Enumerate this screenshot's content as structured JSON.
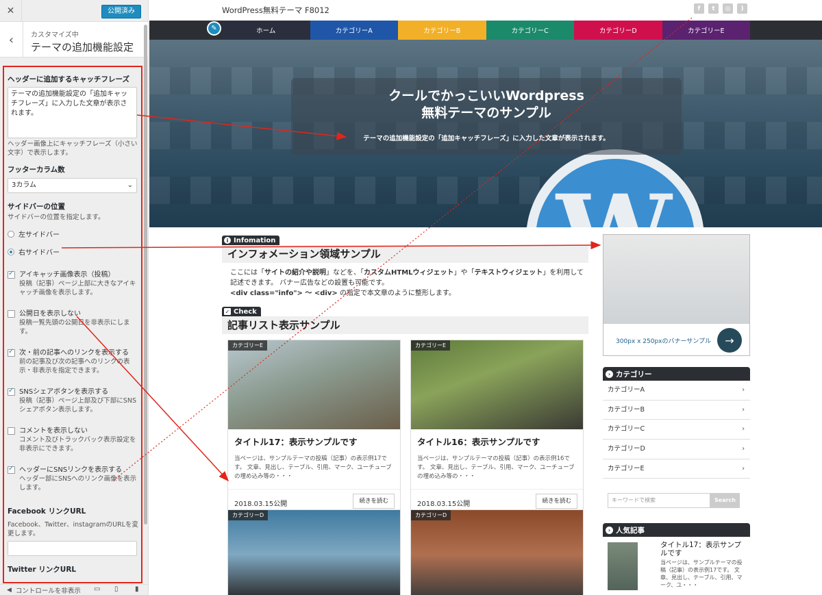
{
  "customizer": {
    "publish_label": "公開済み",
    "section_subtitle": "カスタマイズ中",
    "section_title": "テーマの追加機能設定",
    "catchphrase_label": "ヘッダーに追加するキャッチフレーズ",
    "catchphrase_value": "テーマの追加機能設定の「追加キャッチフレーズ」に入力した文章が表示されます。",
    "catchphrase_desc": "ヘッダー画像上にキャッチフレーズ（小さい文字）で表示します。",
    "footer_cols_label": "フッターカラム数",
    "footer_cols_value": "3カラム",
    "sidebar_pos_label": "サイドバーの位置",
    "sidebar_pos_desc": "サイドバーの位置を指定します。",
    "radio_left": "左サイドバー",
    "radio_right": "右サイドバー",
    "checks": [
      {
        "title": "アイキャッチ画像表示（投稿）",
        "desc": "投稿（記事）ページ上部に大きなアイキャッチ画像を表示します。",
        "checked": true
      },
      {
        "title": "公開日を表示しない",
        "desc": "投稿一覧先頭の公開日を非表示にします。",
        "checked": false
      },
      {
        "title": "次・前の記事へのリンクを表示する",
        "desc": "前の記事及び次の記事へのリンクの表示・非表示を指定できます。",
        "checked": true
      },
      {
        "title": "SNSシェアボタンを表示する",
        "desc": "投稿（記事）ページ上部及び下部にSNSシェアボタン表示します。",
        "checked": true
      },
      {
        "title": "コメントを表示しない",
        "desc": "コメント及びトラックバック表示設定を非表示にできます。",
        "checked": false
      },
      {
        "title": "ヘッダーにSNSリンクを表示する",
        "desc": "ヘッダー部にSNSへのリンク画像を表示します。",
        "checked": true
      }
    ],
    "facebook_label": "Facebook リンクURL",
    "facebook_desc": "Facebook、Twitter、instagramのURLを変更します。",
    "twitter_label": "Twitter リンクURL",
    "hide_controls": "コントロールを非表示"
  },
  "site": {
    "title": "WordPress無料テーマ F8012",
    "nav": [
      {
        "label": "ホーム",
        "color": "#2b2f3d"
      },
      {
        "label": "カテゴリーA",
        "color": "#1f56a8"
      },
      {
        "label": "カテゴリーB",
        "color": "#f2b028"
      },
      {
        "label": "カテゴリーC",
        "color": "#1b8a6b"
      },
      {
        "label": "カテゴリーD",
        "color": "#d0104d"
      },
      {
        "label": "カテゴリーE",
        "color": "#5b2270"
      }
    ],
    "hero_title_1": "クールでかっこいいWordpress",
    "hero_title_2": "無料テーマのサンプル",
    "hero_catchphrase": "テーマの追加機能設定の「追加キャッチフレーズ」に入力した文章が表示されます。",
    "info_tag": "Infomation",
    "info_heading": "インフォメーション領域サンプル",
    "info_text": {
      "p1": "ここには「",
      "b1": "サイトの紹介や説明",
      "p2": "」などを、「",
      "b2": "カスタムHTMLウィジェット",
      "p3": "」や「",
      "b3": "テキストウィジェット",
      "p4": "」を利用して記述できます。 バナー広告などの設置も可能です。",
      "b4": "<div class=\"info\"> 〜 <div>",
      "p5": " の指定で本文章のように整形します。"
    },
    "check_tag": "Check",
    "list_heading": "記事リスト表示サンプル",
    "cards": [
      {
        "category": "カテゴリーE",
        "title": "タイトル17：表示サンプルです",
        "excerpt": "当ページは、サンプルテーマの投稿（記事）の表示例17です。 文章、見出し、テーブル、引用、マーク、ユーチューブの埋め込み等の・・・",
        "date": "2018.03.15公開",
        "more": "続きを読む"
      },
      {
        "category": "カテゴリーE",
        "title": "タイトル16：表示サンプルです",
        "excerpt": "当ページは、サンプルテーマの投稿（記事）の表示例16です。 文章、見出し、テーブル、引用、マーク、ユーチューブの埋め込み等の・・・",
        "date": "2018.03.15公開",
        "more": "続きを読む"
      },
      {
        "category": "カテゴリーD"
      },
      {
        "category": "カテゴリーD"
      }
    ],
    "banner_text": "300px x 250pxのバナーサンプル",
    "category_widget": "カテゴリー",
    "categories": [
      "カテゴリーA",
      "カテゴリーB",
      "カテゴリーC",
      "カテゴリーD",
      "カテゴリーE"
    ],
    "search_placeholder": "キーワードで検索",
    "search_button": "Search",
    "popular_widget": "人気記事",
    "popular_title": "タイトル17：表示サンプルです",
    "popular_excerpt": "当ページは、サンプルテーマの投稿（記事）の表示例17です。 文章、見出し、テーブル、引用、マーク、ユ・・・"
  },
  "colors": {
    "annotation_red": "#e0261b",
    "wp_blue": "#1e8cbe"
  }
}
